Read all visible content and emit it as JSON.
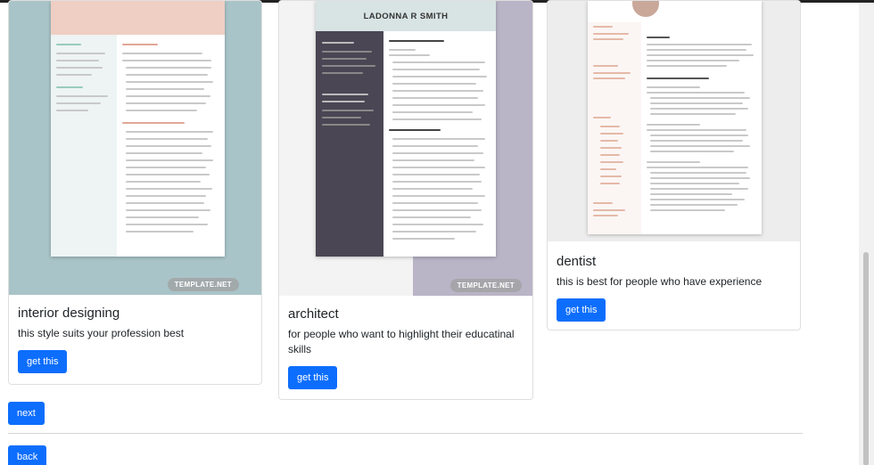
{
  "cards": [
    {
      "title": "interior designing",
      "description": "this style suits your profession best",
      "button": "get this",
      "badge": "TEMPLATE.NET",
      "accent": "#a8c3c7"
    },
    {
      "title": "architect",
      "description": "for people who want to highlight their educatinal skills",
      "button": "get this",
      "badge": "TEMPLATE.NET",
      "resume_name": "LADONNA R SMITH",
      "accent": "#4a4654"
    },
    {
      "title": "dentist",
      "description": "this is best for people who have experience",
      "button": "get this",
      "accent": "#e9c3b4"
    }
  ],
  "nav": {
    "next": "next",
    "back": "back"
  },
  "colors": {
    "primary_button": "#0d6efd"
  }
}
